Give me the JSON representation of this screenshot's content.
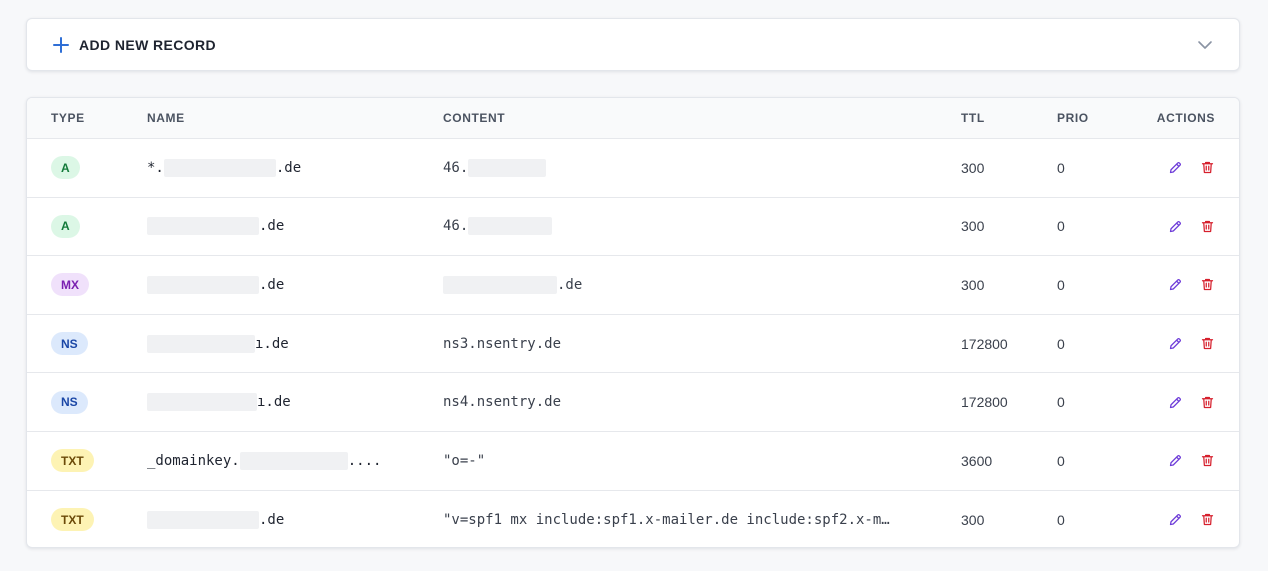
{
  "add_record": {
    "label": "ADD NEW RECORD",
    "icon": "plus-icon",
    "toggle_icon": "chevron-down-icon"
  },
  "columns": {
    "type": "TYPE",
    "name": "NAME",
    "content": "CONTENT",
    "ttl": "TTL",
    "prio": "PRIO",
    "actions": "ACTIONS"
  },
  "colors": {
    "accent": "#2f6fd6",
    "edit": "#6d3bd8",
    "delete": "#d61f2c",
    "badge_A_bg": "#dcf7e6",
    "badge_A_fg": "#137a3a",
    "badge_MX_bg": "#f0e1fb",
    "badge_MX_fg": "#7a1fb0",
    "badge_NS_bg": "#dce9fc",
    "badge_NS_fg": "#1b47a6",
    "badge_TXT_bg": "#fdf3b4",
    "badge_TXT_fg": "#6b4a08"
  },
  "records": [
    {
      "type": "A",
      "name_prefix": "*.",
      "name_suffix": ".de",
      "content_prefix": "46.",
      "content_suffix": "",
      "ttl": "300",
      "prio": "0"
    },
    {
      "type": "A",
      "name_prefix": "",
      "name_suffix": ".de",
      "content_prefix": "46.",
      "content_suffix": "",
      "ttl": "300",
      "prio": "0"
    },
    {
      "type": "MX",
      "name_prefix": "",
      "name_suffix": ".de",
      "content_prefix": "",
      "content_suffix": ".de",
      "ttl": "300",
      "prio": "0"
    },
    {
      "type": "NS",
      "name_prefix": "",
      "name_suffix": "ı.de",
      "content_prefix": "ns3.nsentry.de",
      "content_suffix": "",
      "ttl": "172800",
      "prio": "0"
    },
    {
      "type": "NS",
      "name_prefix": "",
      "name_suffix": "ı.de",
      "content_prefix": "ns4.nsentry.de",
      "content_suffix": "",
      "ttl": "172800",
      "prio": "0"
    },
    {
      "type": "TXT",
      "name_prefix": "_domainkey.",
      "name_suffix": "....",
      "content_prefix": "\"o=-\"",
      "content_suffix": "",
      "ttl": "3600",
      "prio": "0"
    },
    {
      "type": "TXT",
      "name_prefix": "",
      "name_suffix": ".de",
      "content_prefix": "\"v=spf1 mx include:spf1.x-mailer.de include:spf2.x-m…",
      "content_suffix": "",
      "ttl": "300",
      "prio": "0"
    }
  ],
  "actions": {
    "edit_icon": "pencil-icon",
    "delete_icon": "trash-icon"
  }
}
